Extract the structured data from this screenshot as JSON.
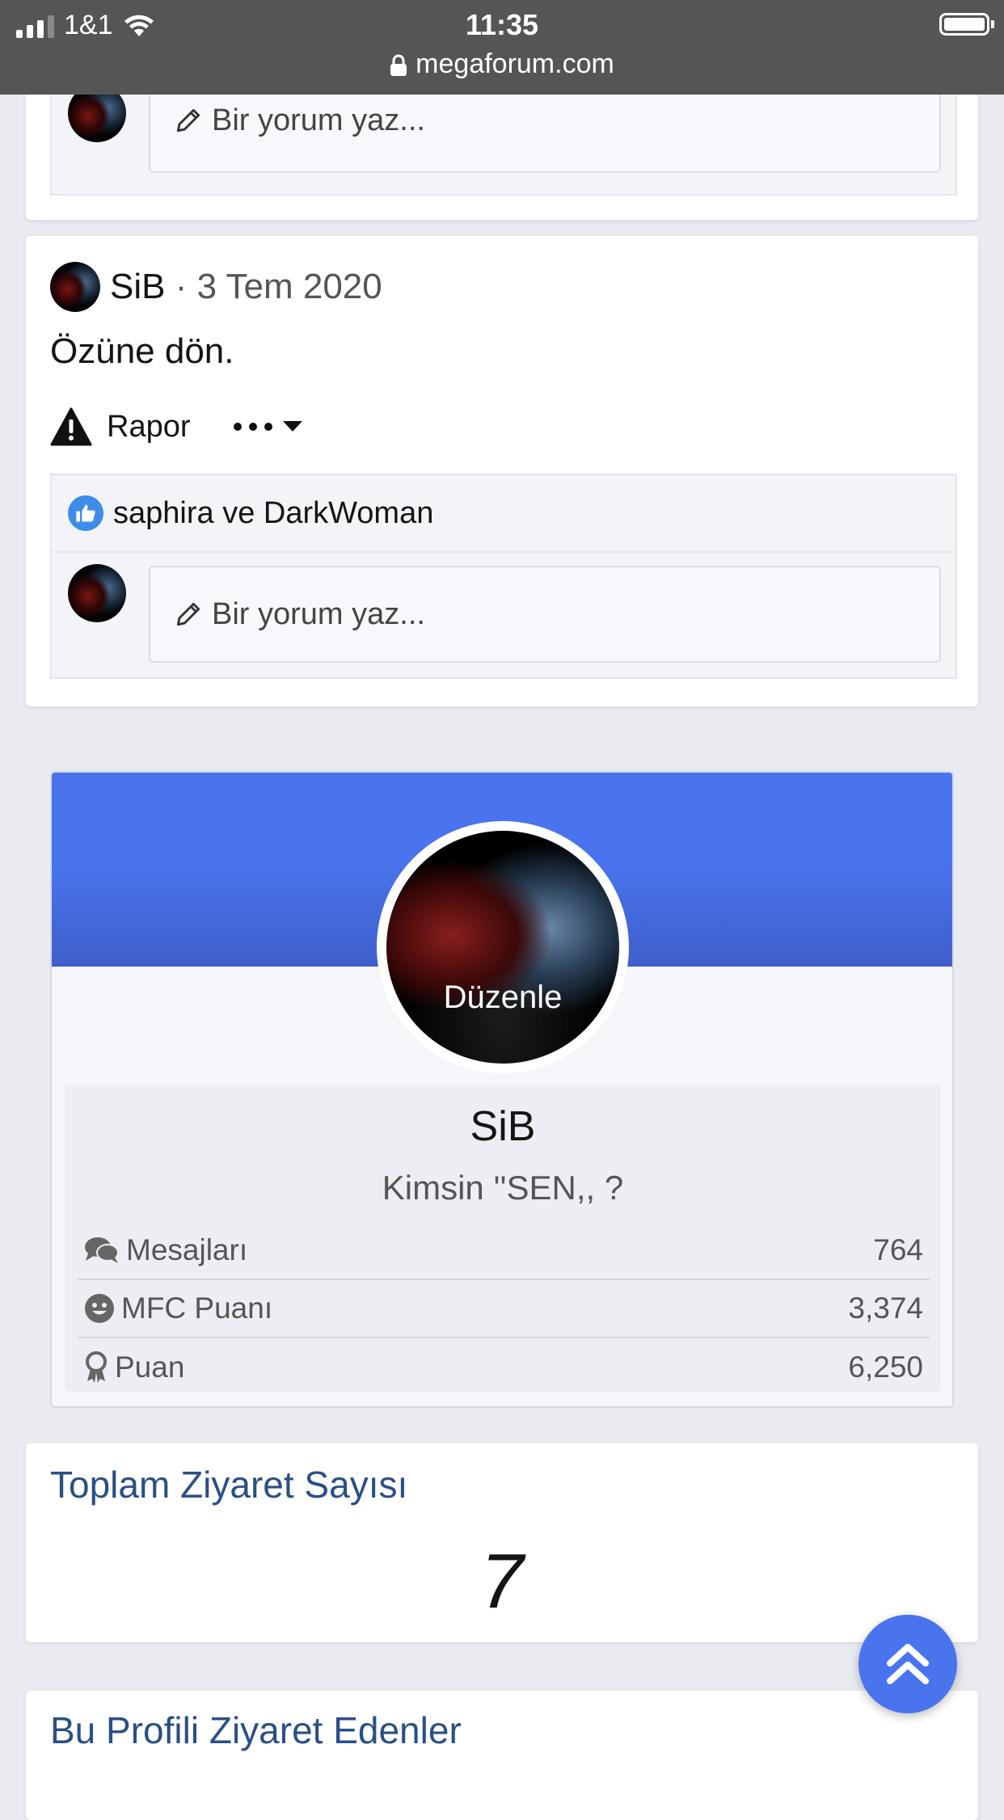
{
  "status_bar": {
    "carrier": "1&1",
    "time": "11:35",
    "url": "megaforum.com"
  },
  "top_comment": {
    "placeholder": "Bir yorum yaz..."
  },
  "post": {
    "author": "SiB",
    "date": "· 3 Tem 2020",
    "body": "Özüne dön.",
    "report_label": "Rapor",
    "likes_text": "saphira ve DarkWoman",
    "comment_placeholder": "Bir yorum yaz..."
  },
  "profile": {
    "edit_label": "Düzenle",
    "name": "SiB",
    "user_title": "Kimsin ''SEN,, ?",
    "stats": [
      {
        "icon": "comments-icon",
        "label": "Mesajları",
        "value": "764"
      },
      {
        "icon": "smile-icon",
        "label": "MFC Puanı",
        "value": "3,374"
      },
      {
        "icon": "award-icon",
        "label": "Puan",
        "value": "6,250"
      }
    ]
  },
  "visits": {
    "title": "Toplam Ziyaret Sayısı",
    "count": "7"
  },
  "visitors": {
    "title": "Bu Profili Ziyaret Edenler"
  },
  "colors": {
    "banner": "#4a74ee",
    "section_title": "#2a4f85",
    "fab": "#4a74ee"
  }
}
